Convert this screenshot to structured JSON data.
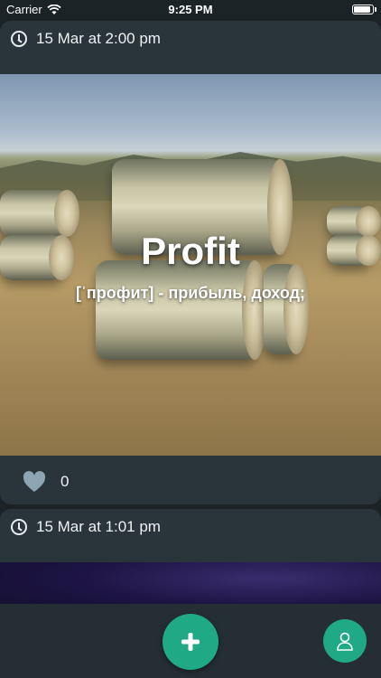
{
  "status_bar": {
    "carrier": "Carrier",
    "time": "9:25 PM"
  },
  "posts": [
    {
      "timestamp": "15 Mar at 2:00 pm",
      "word": "Profit",
      "transcription": "[ˈпрофит] - прибыль, доход;",
      "likes": "0"
    },
    {
      "timestamp": "15 Mar at 1:01 pm"
    }
  ],
  "colors": {
    "accent": "#1fa985",
    "card": "#29353a",
    "background": "#1c2327"
  },
  "icons": {
    "clock": "clock-icon",
    "heart": "heart-icon",
    "add": "plus-icon",
    "profile": "user-icon",
    "wifi": "wifi-icon",
    "battery": "battery-icon"
  }
}
